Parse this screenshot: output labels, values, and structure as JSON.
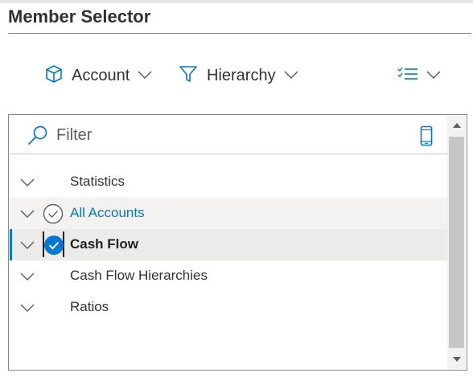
{
  "header": {
    "title": "Member Selector"
  },
  "toolbar": {
    "dimension_label": "Account",
    "hierarchy_label": "Hierarchy"
  },
  "filter": {
    "placeholder": "Filter"
  },
  "tree": {
    "items": [
      {
        "label": "Statistics",
        "state": "collapsed"
      },
      {
        "label": "All Accounts",
        "state": "collapsed",
        "checked": false,
        "hovered": true
      },
      {
        "label": "Cash Flow",
        "state": "collapsed",
        "checked": true,
        "selected": true
      },
      {
        "label": "Cash Flow Hierarchies",
        "state": "collapsed"
      },
      {
        "label": "Ratios",
        "state": "collapsed"
      }
    ]
  },
  "colors": {
    "accent": "#0078d4",
    "text": "#323130",
    "hover_bg": "#f3f2f1",
    "selected_bg": "#edebe9"
  },
  "icons": [
    "cube-icon",
    "filter-funnel-icon",
    "checklist-icon",
    "search-icon",
    "mobile-device-icon",
    "chevron-down-icon",
    "check-circle-icon"
  ]
}
